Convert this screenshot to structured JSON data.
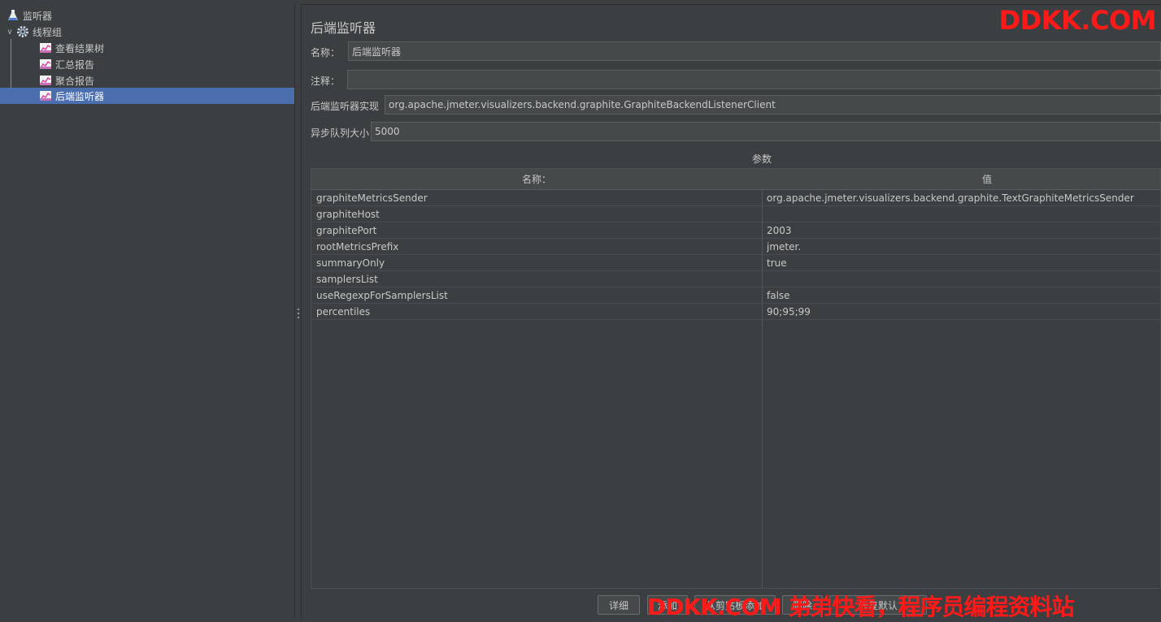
{
  "tree": {
    "items": [
      {
        "label": "监听器",
        "icon": "flask-icon",
        "level": 0
      },
      {
        "label": "线程组",
        "icon": "gear-icon",
        "level": 1,
        "expanded": true
      },
      {
        "label": "查看结果树",
        "icon": "graph-icon",
        "level": 2
      },
      {
        "label": "汇总报告",
        "icon": "graph-icon",
        "level": 2
      },
      {
        "label": "聚合报告",
        "icon": "graph-icon",
        "level": 2
      },
      {
        "label": "后端监听器",
        "icon": "graph-icon",
        "level": 2,
        "selected": true
      }
    ]
  },
  "panel": {
    "title": "后端监听器",
    "name_label": "名称：",
    "name_value": "后端监听器",
    "comment_label": "注释：",
    "comment_value": "",
    "impl_label": "后端监听器实现",
    "impl_value": "org.apache.jmeter.visualizers.backend.graphite.GraphiteBackendListenerClient",
    "queue_label": "异步队列大小",
    "queue_value": "5000"
  },
  "params": {
    "title": "参数",
    "columns": [
      "名称：",
      "值"
    ],
    "rows": [
      {
        "name": "graphiteMetricsSender",
        "value": "org.apache.jmeter.visualizers.backend.graphite.TextGraphiteMetricsSender"
      },
      {
        "name": "graphiteHost",
        "value": ""
      },
      {
        "name": "graphitePort",
        "value": "2003"
      },
      {
        "name": "rootMetricsPrefix",
        "value": "jmeter."
      },
      {
        "name": "summaryOnly",
        "value": "true"
      },
      {
        "name": "samplersList",
        "value": ""
      },
      {
        "name": "useRegexpForSamplersList",
        "value": "false"
      },
      {
        "name": "percentiles",
        "value": "90;95;99"
      }
    ]
  },
  "buttons": {
    "detail": "详细",
    "add": "添加",
    "add_from_clipboard": "从剪贴板添加",
    "delete": "删除",
    "restore_defaults": "恢复默认"
  },
  "watermarks": {
    "top": "DDKK.COM",
    "bottom": "DDKK.COM 弟弟快看，程序员编程资料站"
  },
  "colors": {
    "background": "#3c3f41",
    "selection": "#4b6eaf",
    "watermark": "#ff1a1a"
  }
}
